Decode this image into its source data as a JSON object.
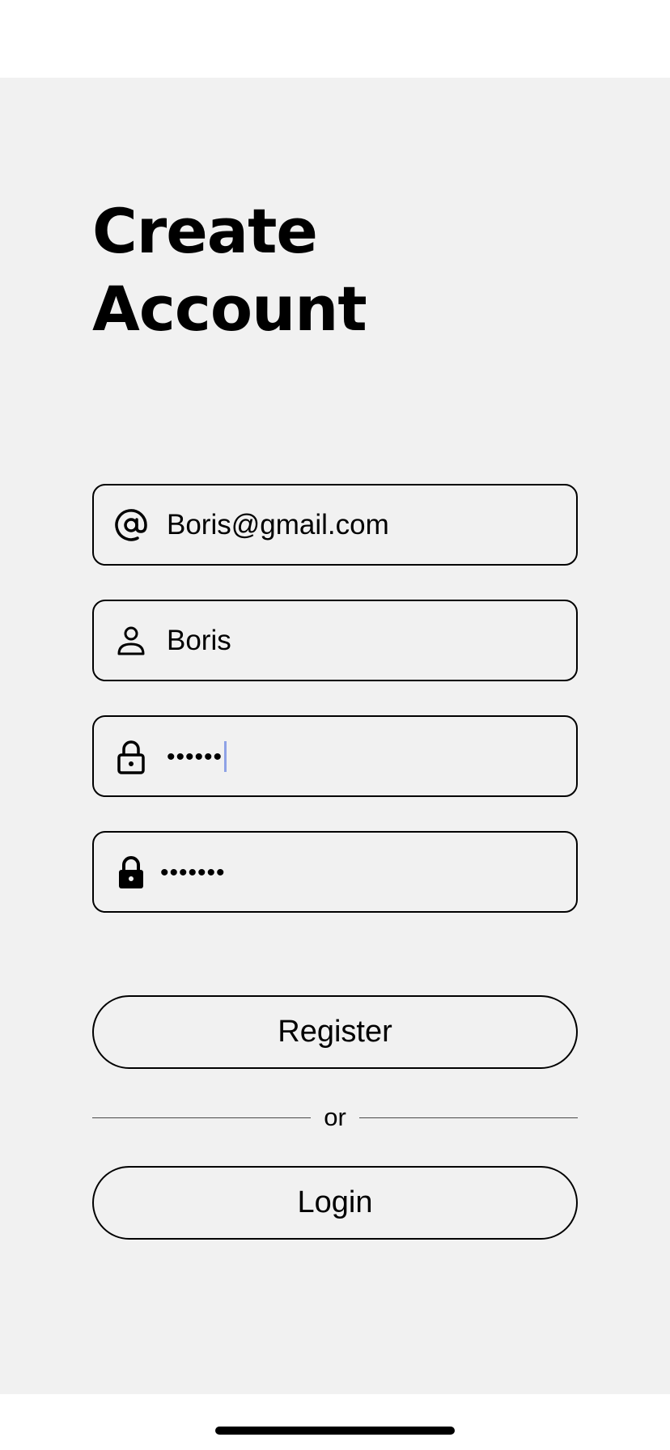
{
  "header": {
    "title_line1": "Create",
    "title_line2": "Account"
  },
  "form": {
    "email": {
      "icon": "at-sign-icon",
      "value": "Boris@gmail.com"
    },
    "name": {
      "icon": "person-icon",
      "value": "Boris"
    },
    "password": {
      "icon": "lock-open-outline-icon",
      "value": "••••••"
    },
    "confirm_password": {
      "icon": "lock-filled-icon",
      "value": "•••••••"
    }
  },
  "actions": {
    "register_label": "Register",
    "divider_label": "or",
    "login_label": "Login"
  },
  "colors": {
    "background": "#f1f1f1",
    "border": "#000000",
    "caret": "#8ea2e6"
  }
}
